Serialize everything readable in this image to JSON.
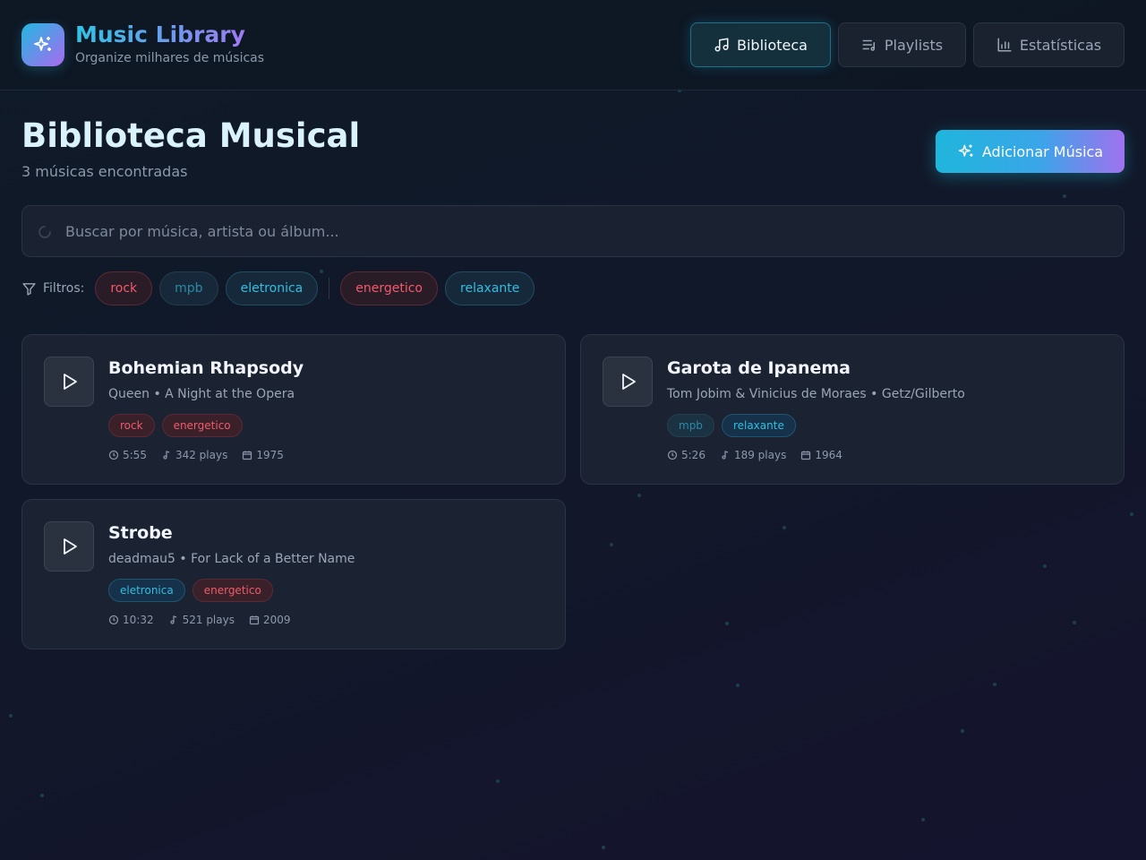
{
  "header": {
    "app_title": "Music Library",
    "app_subtitle": "Organize milhares de músicas",
    "logo_icon": "sparkles-icon",
    "nav": [
      {
        "label": "Biblioteca",
        "icon": "music-note-icon",
        "active": true
      },
      {
        "label": "Playlists",
        "icon": "list-music-icon",
        "active": false
      },
      {
        "label": "Estatísticas",
        "icon": "bar-chart-icon",
        "active": false
      }
    ]
  },
  "page": {
    "title": "Biblioteca Musical",
    "count_text": "3 músicas encontradas",
    "add_button_label": "Adicionar Música"
  },
  "search": {
    "placeholder": "Buscar por música, artista ou álbum...",
    "value": ""
  },
  "filters": {
    "label": "Filtros:",
    "genres": [
      "rock",
      "mpb",
      "eletronica"
    ],
    "moods": [
      "energetico",
      "relaxante"
    ]
  },
  "songs": [
    {
      "title": "Bohemian Rhapsody",
      "meta": "Queen • A Night at the Opera",
      "tags": [
        "rock",
        "energetico"
      ],
      "duration": "5:55",
      "plays": "342 plays",
      "year": "1975"
    },
    {
      "title": "Garota de Ipanema",
      "meta": "Tom Jobim & Vinicius de Moraes • Getz/Gilberto",
      "tags": [
        "mpb",
        "relaxante"
      ],
      "duration": "5:26",
      "plays": "189 plays",
      "year": "1964"
    },
    {
      "title": "Strobe",
      "meta": "deadmau5 • For Lack of a Better Name",
      "tags": [
        "eletronica",
        "energetico"
      ],
      "duration": "10:32",
      "plays": "521 plays",
      "year": "2009"
    }
  ],
  "colors": {
    "accent_cyan": "#22b8e0",
    "accent_purple": "#a96af0",
    "tag_red": "#ef5b6b",
    "tag_teal": "#33bde0"
  }
}
